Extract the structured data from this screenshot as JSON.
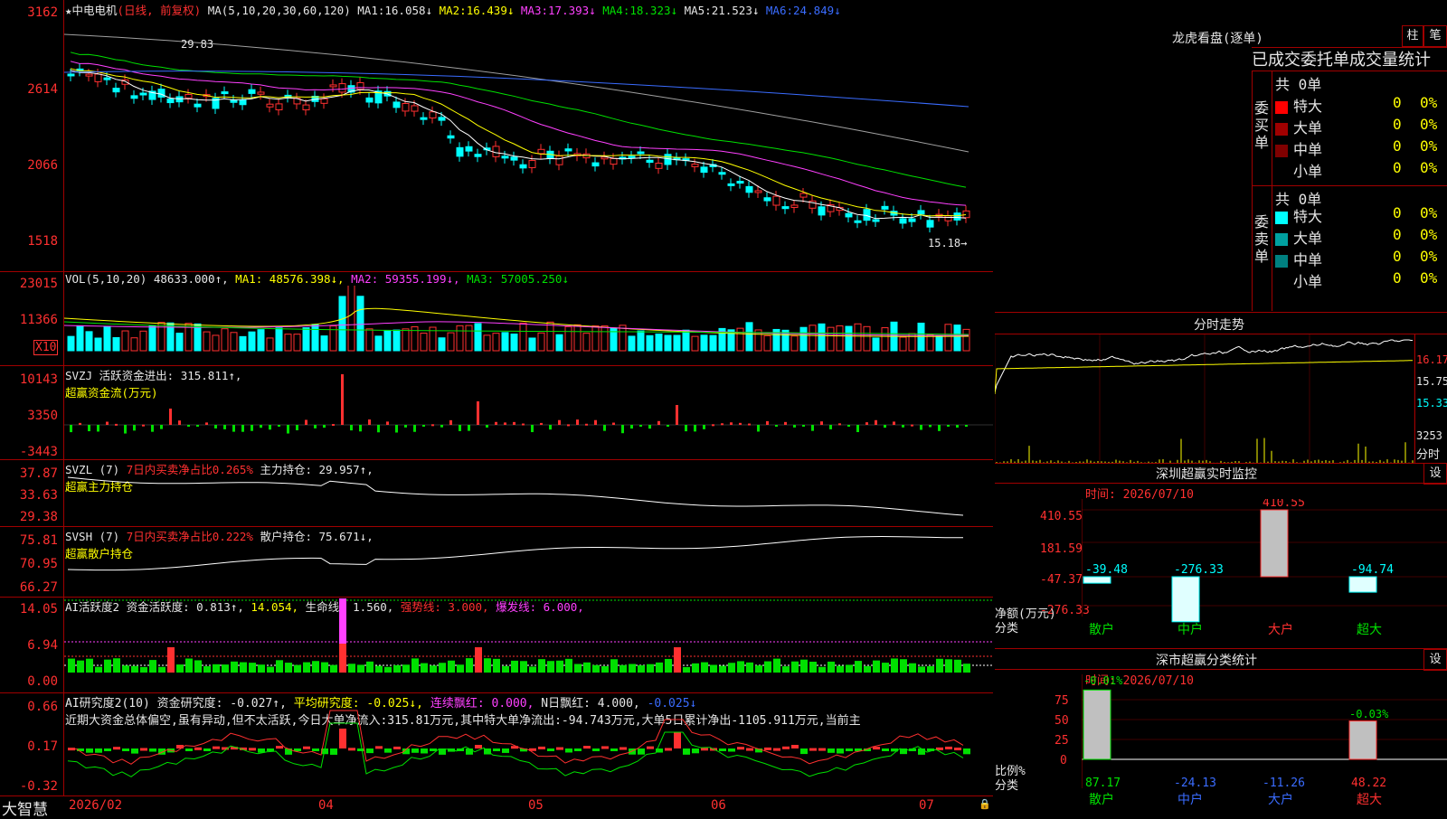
{
  "main": {
    "title_star": "★",
    "stock_name": "中电电机",
    "period_label": "(日线, 前复权)",
    "ma_def": "MA(5,10,20,30,60,120)",
    "ma1_label": "MA1:",
    "ma1_val": "16.058↓",
    "ma2_label": "MA2:",
    "ma2_val": "16.439↓",
    "ma3_label": "MA3:",
    "ma3_val": "17.393↓",
    "ma4_label": "MA4:",
    "ma4_val": "18.323↓",
    "ma5_label": "MA5:",
    "ma5_val": "21.523↓",
    "ma6_label": "MA6:",
    "ma6_val": "24.849↓",
    "high_mark": "29.83",
    "low_mark": "15.18→",
    "y_ticks": [
      "3162",
      "2614",
      "2066",
      "1518"
    ]
  },
  "vol": {
    "def": "VOL(5,10,20)",
    "value": "48633.000↑,",
    "ma1": "MA1: 48576.398↓,",
    "ma2": "MA2: 59355.199↓,",
    "ma3": "MA3: 57005.250↓",
    "y_ticks": [
      "23015",
      "11366"
    ],
    "unit": "X10"
  },
  "svzj": {
    "def": "SVZJ",
    "label": "活跃资金进出: 315.811↑,",
    "sub": "超赢资金流(万元)",
    "y_ticks": [
      "10143",
      "3350",
      "-3443"
    ]
  },
  "svzl": {
    "def": "SVZL (7)",
    "red": "7日内买卖净占比0.265%",
    "label": "主力持仓: 29.957↑,",
    "sub": "超赢主力持仓",
    "y_ticks": [
      "37.87",
      "33.63",
      "29.38"
    ]
  },
  "svsh": {
    "def": "SVSH (7)",
    "red": "7日内买卖净占比0.222%",
    "label": "散户持仓: 75.671↓,",
    "sub": "超赢散户持仓",
    "y_ticks": [
      "75.81",
      "70.95",
      "66.27"
    ]
  },
  "ai1": {
    "def": "AI活跃度2",
    "label": "资金活跃度: 0.813↑,",
    "v2": "14.054,",
    "life": "生命线: 1.560,",
    "strong": "强势线: 3.000,",
    "burst": "爆发线: 6.000,",
    "y_ticks": [
      "14.05",
      "6.94",
      "0.00"
    ]
  },
  "ai2": {
    "def": "AI研究度2(10)",
    "label": "资金研究度: -0.027↑,",
    "avg": "平均研究度: -0.025↓,",
    "red1": "连续飘红: 0.000,",
    "red2": "N日飘红: 4.000,",
    "last": "-0.025↓",
    "text": "近期大资金总体偏空,虽有异动,但不太活跃,今日大单净流入:315.81万元,其中特大单净流出:-94.743万元,大单5日累计净出-1105.911万元,当前主",
    "y_ticks": [
      "0.66",
      "0.17",
      "-0.32"
    ]
  },
  "xaxis": {
    "labels": [
      "2026/02",
      "04",
      "05",
      "06",
      "07"
    ],
    "brand": "大智慧"
  },
  "lhb": {
    "title": "龙虎看盘(逐单)",
    "btn1": "柱",
    "btn2": "笔",
    "subtitle": "已成交委托单成交量统计",
    "buy_side": "委买单",
    "sell_side": "委卖单",
    "buy_total": "共 0单",
    "sell_total": "共 0单",
    "rows": [
      {
        "label": "特大",
        "val": "0",
        "pct": "0%"
      },
      {
        "label": "大单",
        "val": "0",
        "pct": "0%"
      },
      {
        "label": "中单",
        "val": "0",
        "pct": "0%"
      },
      {
        "label": "小单",
        "val": "0",
        "pct": "0%"
      }
    ],
    "srows": [
      {
        "label": "特大",
        "val": "0",
        "pct": "0%"
      },
      {
        "label": "大单",
        "val": "0",
        "pct": "0%"
      },
      {
        "label": "中单",
        "val": "0",
        "pct": "0%"
      },
      {
        "label": "小单",
        "val": "0",
        "pct": "0%"
      }
    ]
  },
  "intraday": {
    "title": "分时走势",
    "prices": [
      "16.17",
      "15.75",
      "15.33"
    ],
    "vol": "3253",
    "unit": "分时"
  },
  "monitor": {
    "title": "深圳超赢实时监控",
    "btn": "设",
    "time": "时间: 2026/07/10",
    "y_ticks": [
      "410.55",
      "181.59",
      "-47.37",
      "-276.33"
    ],
    "y_label": "净额(万元)",
    "x_label": "分类",
    "cats": [
      "散户",
      "中户",
      "大户",
      "超大"
    ],
    "vals": [
      "-39.48",
      "-276.33",
      "410.55",
      "-94.74"
    ]
  },
  "classify": {
    "title": "深市超赢分类统计",
    "btn": "设",
    "time": "时间: 2026/07/10",
    "y_ticks": [
      "75",
      "50",
      "25",
      "0"
    ],
    "y_label": "比例%",
    "x_label": "分类",
    "cats": [
      "散户",
      "中户",
      "大户",
      "超大"
    ],
    "vals": [
      "87.17",
      "-24.13",
      "-11.26",
      "48.22"
    ],
    "top_labels": [
      "-0.01%",
      "-0.03%"
    ]
  },
  "colors": {
    "up": "#ff3030",
    "down": "#00ffff",
    "grid": "#a00000"
  }
}
